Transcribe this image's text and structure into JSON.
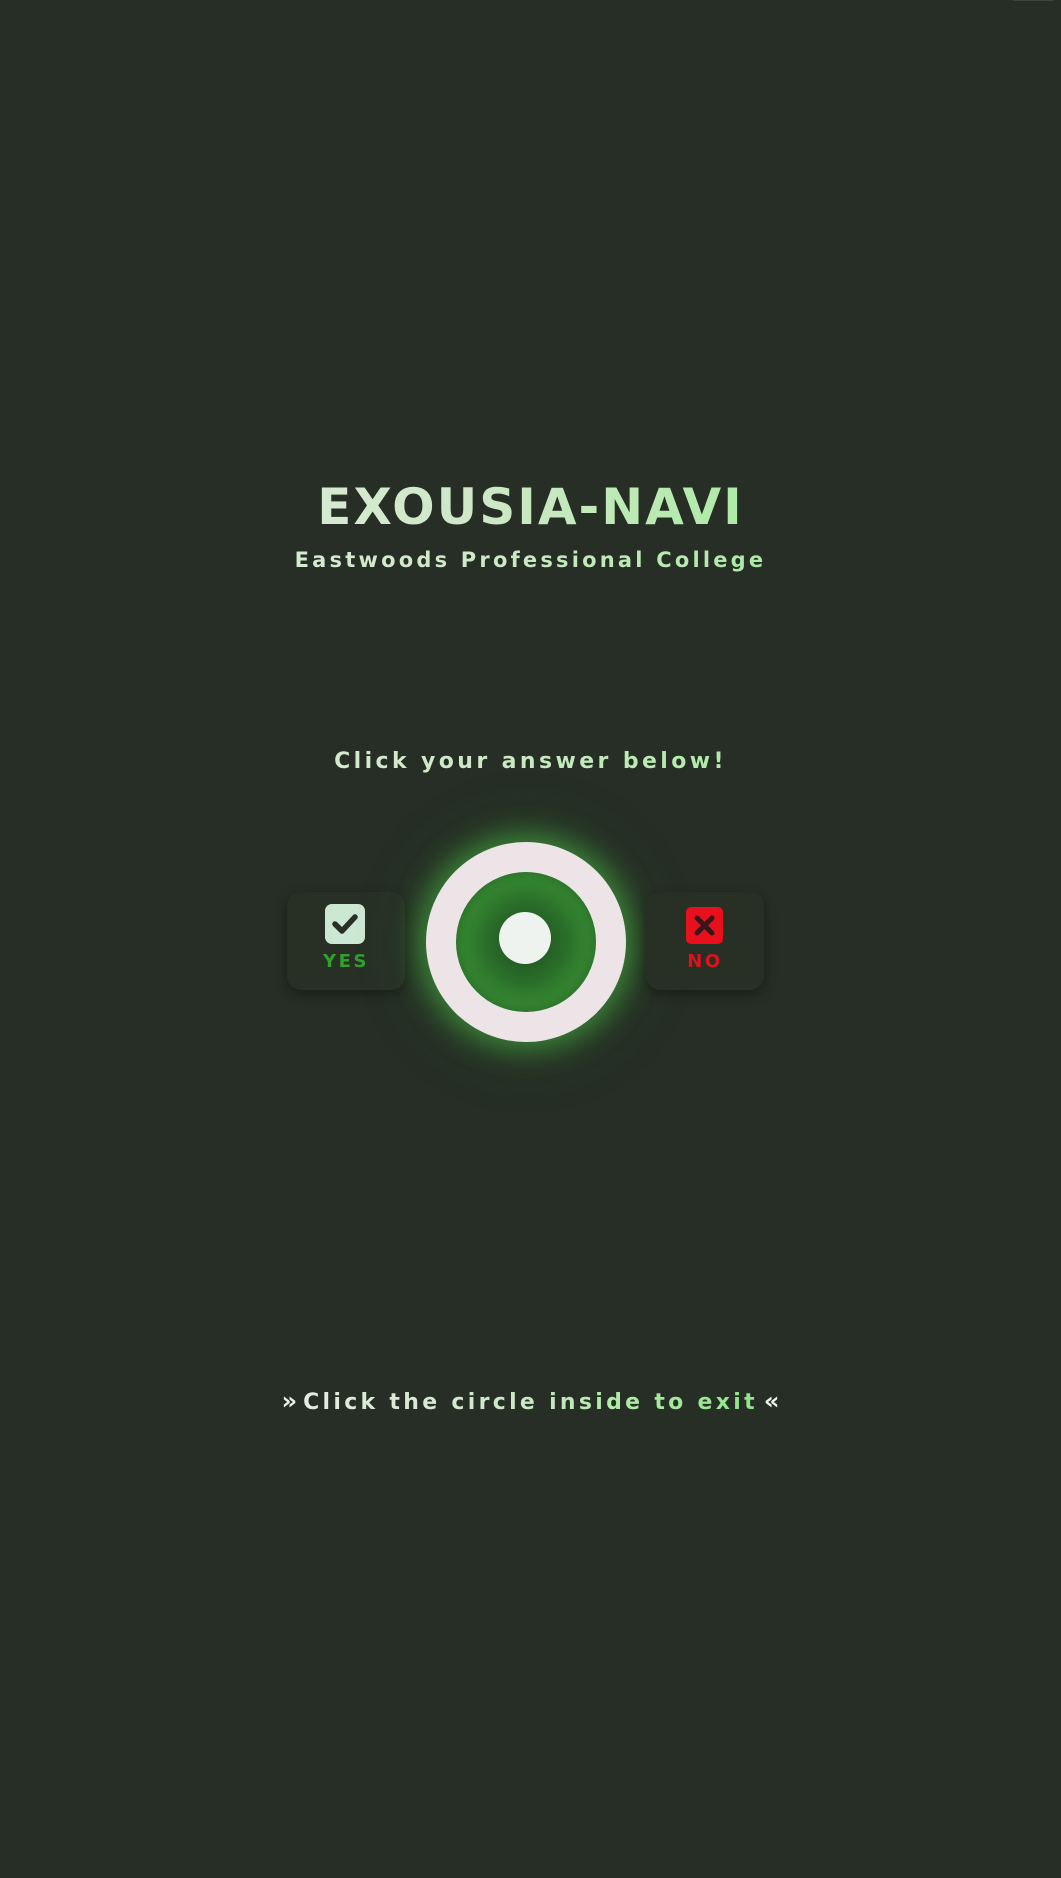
{
  "app": {
    "title": "EXOUSIA-NAVI",
    "subtitle": "Eastwoods Professional College"
  },
  "question": {
    "prompt": "Click your answer below!"
  },
  "answers": {
    "yes": {
      "label": "YES",
      "icon": "check-icon",
      "color": "#2fa02c"
    },
    "no": {
      "label": "NO",
      "icon": "x-icon",
      "color": "#e0101c"
    }
  },
  "exit": {
    "hint": "Click the circle inside to exit",
    "left_marker": "»",
    "right_marker": "«",
    "ring_glow_color": "#4abe46"
  },
  "colors": {
    "background": "#262e25",
    "accent": "#8fe388",
    "text_light": "#e2ece0"
  }
}
